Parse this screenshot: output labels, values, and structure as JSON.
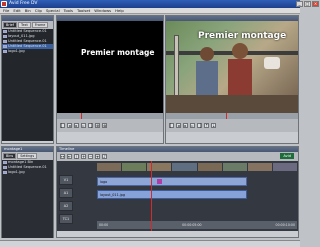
{
  "app": {
    "title": "Avid Free DV"
  },
  "window_controls": [
    "_",
    "□",
    "×"
  ],
  "menu": [
    "File",
    "Edit",
    "Bin",
    "Clip",
    "Special",
    "Tools",
    "Toolset",
    "Windows",
    "Help"
  ],
  "bin_panel": {
    "title": "",
    "tabs": [
      "Brief",
      "Text",
      "Frame"
    ],
    "items": [
      {
        "label": "Untitled Sequence.01",
        "selected": false
      },
      {
        "label": "layout_011.jpg",
        "selected": false
      },
      {
        "label": "Untitled Sequence.01",
        "selected": false
      },
      {
        "label": "Untitled Sequence.01",
        "selected": true
      },
      {
        "label": "logo1.jpg",
        "selected": false
      }
    ]
  },
  "source_monitor": {
    "header": "",
    "title_overlay": "Premier montage",
    "timecode": ""
  },
  "record_monitor": {
    "header": "",
    "sequence_name": "Untitled Sequence.01",
    "title_overlay": "Premier montage"
  },
  "project_panel": {
    "title": "montage1",
    "tabs": [
      "Bins",
      "Settings"
    ],
    "items": [
      {
        "label": "montage1 Bin",
        "selected": false
      },
      {
        "label": "Untitled Sequence.01",
        "selected": false
      },
      {
        "label": "logo1.jpg",
        "selected": false
      }
    ]
  },
  "timeline": {
    "header": "Timeline",
    "track_labels": [
      "V1",
      "A1",
      "A2",
      "TC1"
    ],
    "clips": [
      {
        "track": "V1",
        "label": "logo",
        "type": "video"
      },
      {
        "track": "A1",
        "label": "layout_011.jpg",
        "type": "audio"
      }
    ],
    "time_ruler": [
      "00:00",
      "00:00:05:00",
      "00:00:10:00"
    ],
    "mode_label": "Avid"
  },
  "colors": {
    "title_bar": "#1d3f8c",
    "viewer_bg": "#000000",
    "timeline_bg": "#343841",
    "clip": "#8ea6d6",
    "playhead": "#d62a2a"
  }
}
